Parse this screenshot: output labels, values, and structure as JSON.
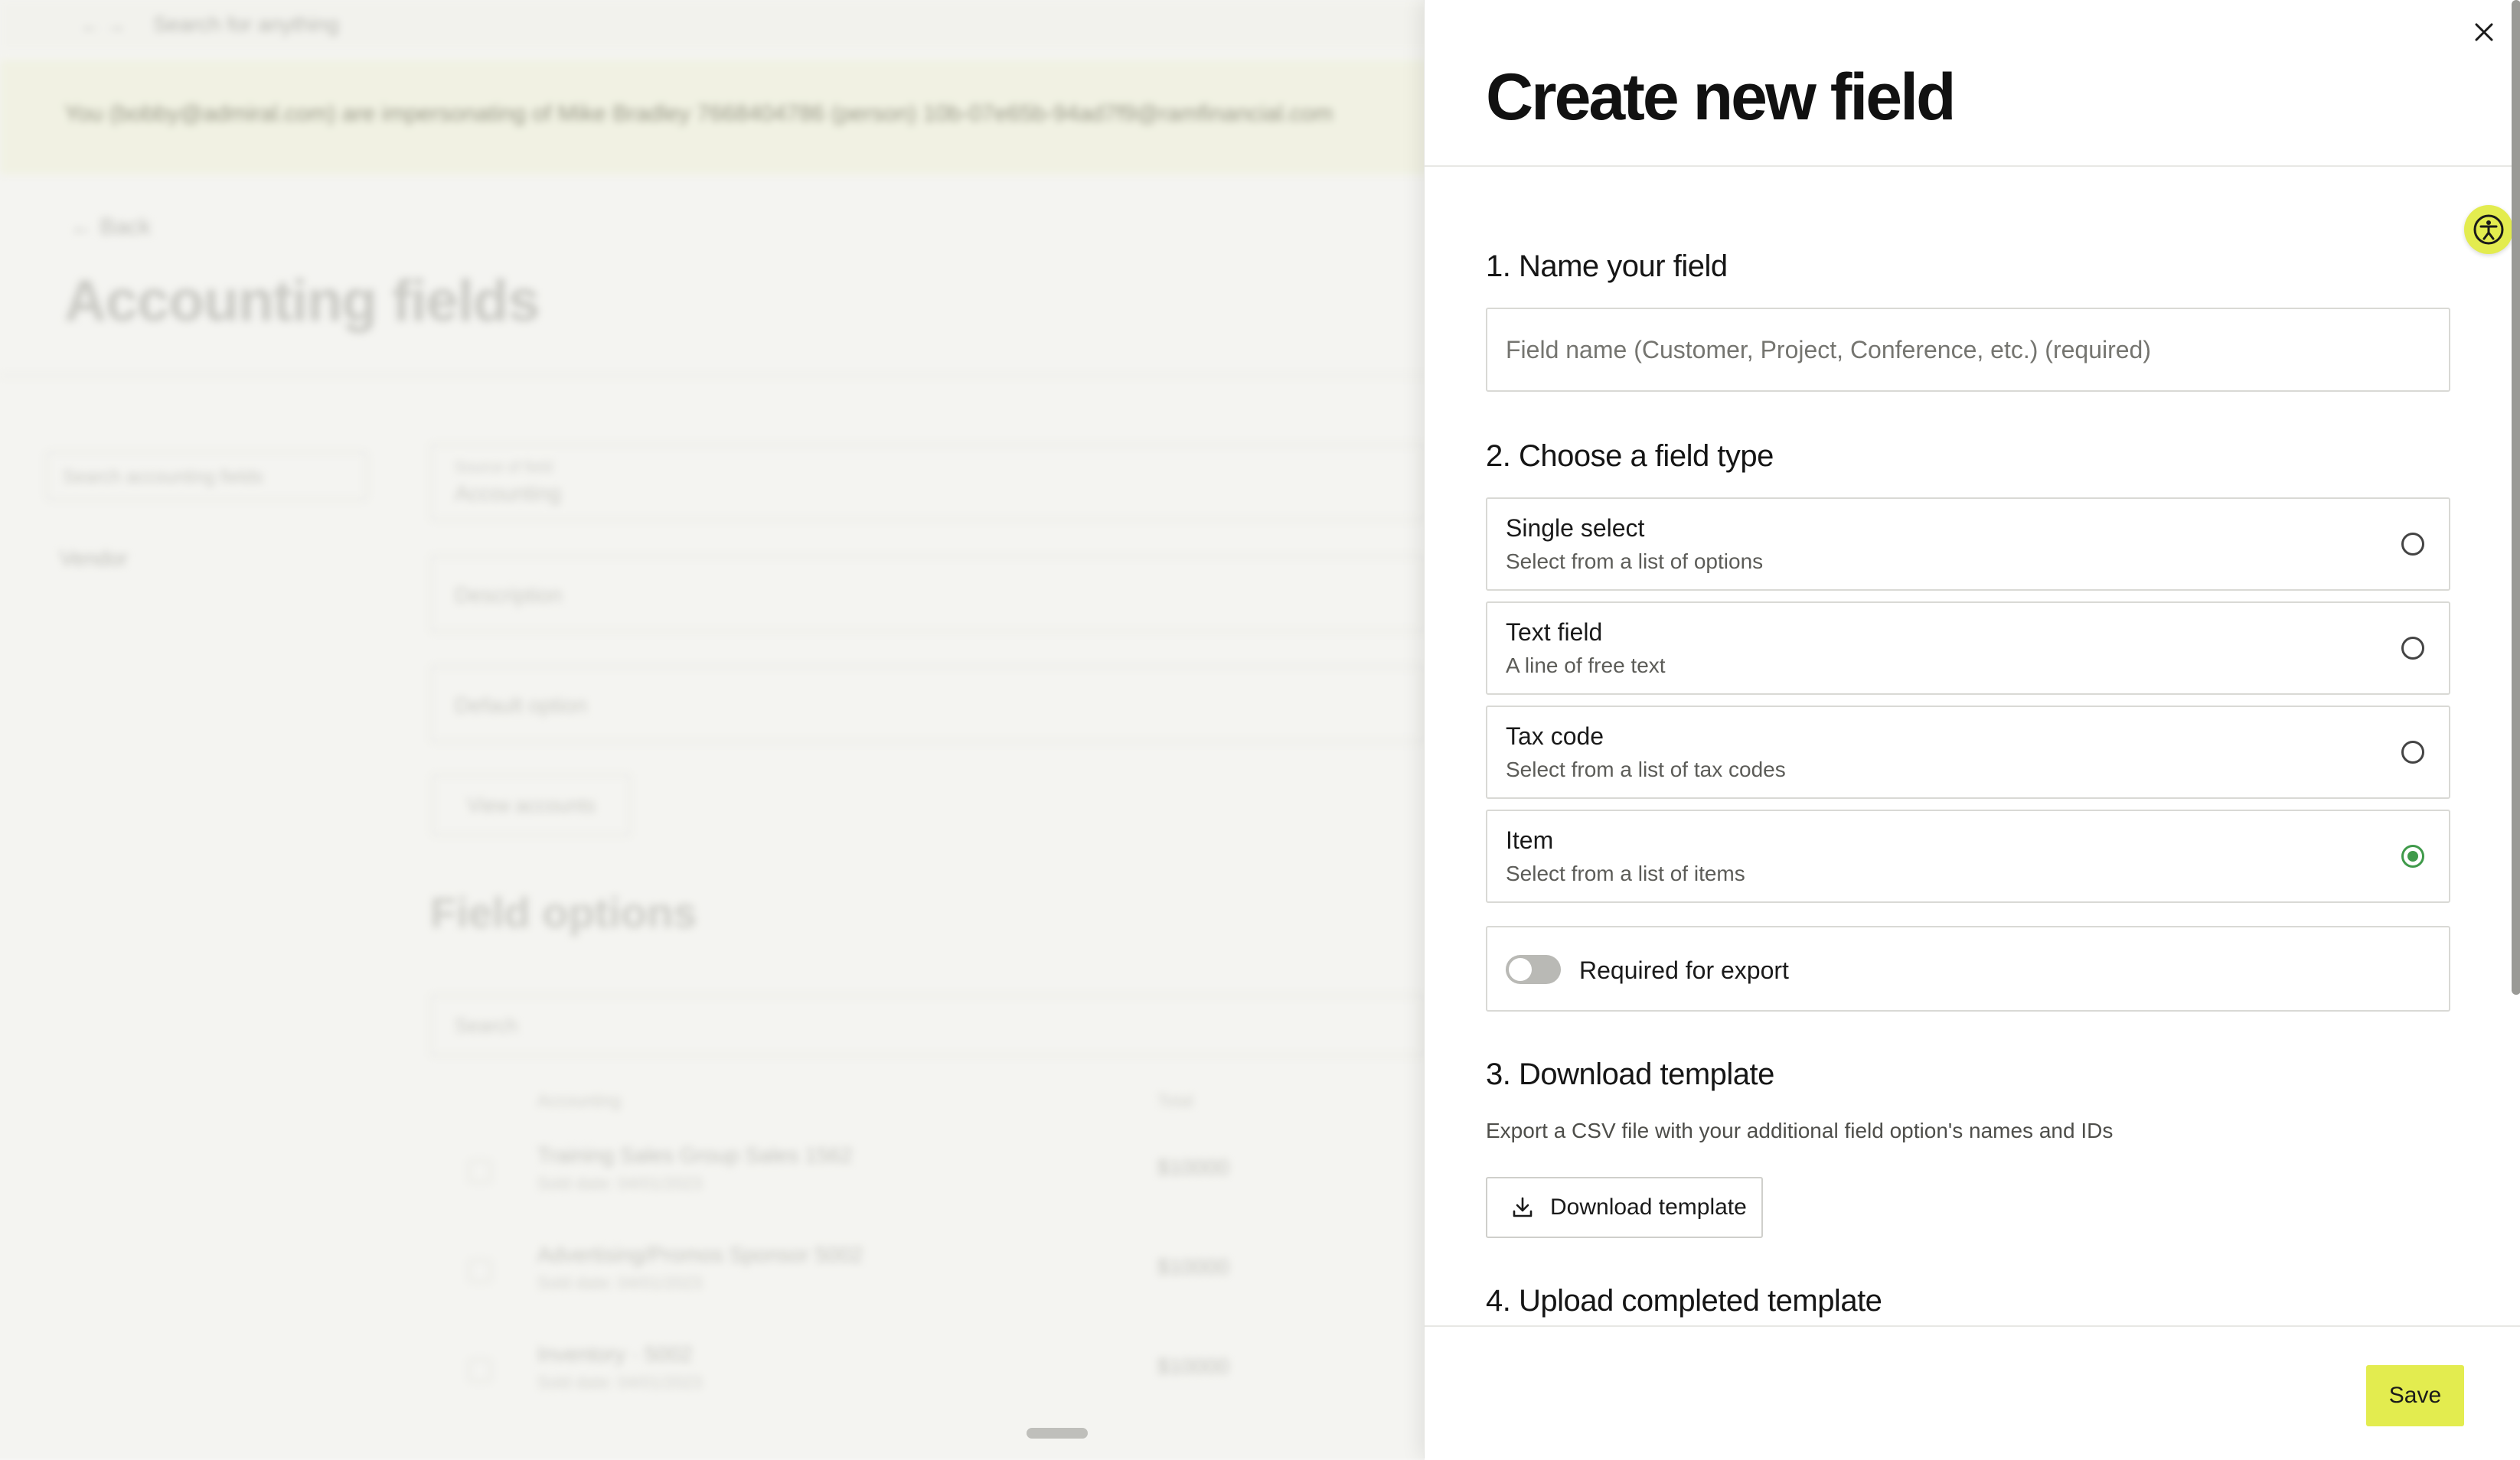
{
  "background": {
    "topbar": {
      "nav": "← →",
      "search_placeholder": "Search for anything"
    },
    "banner_text": "You (bobby@admiral.com) are impersonating of Mike Bradley 7668404786 (person) 10b-07e65b-94ad7f9@ramfinancial.com",
    "back_label": "← Back",
    "page_title": "Accounting fields",
    "sidebar": {
      "search_placeholder": "Search accounting fields",
      "item_label": "Vendor"
    },
    "fields": [
      {
        "label": "Source of field",
        "value": "Accounting"
      },
      {
        "label": "",
        "value": "Description"
      },
      {
        "label": "",
        "value": "Default option"
      }
    ],
    "view_button": "View accounts",
    "options_heading": "Field options",
    "table": {
      "search_placeholder": "Search",
      "headers": [
        "Accounting",
        "Total"
      ],
      "rows": [
        {
          "name": "Training Sales Group Sales 1562",
          "meta": "Sold date: 04/01/2023",
          "amount": "$10000"
        },
        {
          "name": "Advertising/Promos Sponsor 5002",
          "meta": "Sold date: 04/01/2023",
          "amount": "$10000"
        },
        {
          "name": "Inventory · 5002",
          "meta": "Sold date: 04/01/2023",
          "amount": "$10000"
        }
      ]
    }
  },
  "drawer": {
    "title": "Create new field",
    "close_icon": "close-icon",
    "accessibility_icon": "accessibility-icon",
    "section1": {
      "heading": "1. Name your field",
      "placeholder": "Field name (Customer, Project, Conference, etc.) (required)",
      "value": ""
    },
    "section2": {
      "heading": "2. Choose a field type",
      "options": [
        {
          "title": "Single select",
          "description": "Select from a list of options",
          "selected": false
        },
        {
          "title": "Text field",
          "description": "A line of free text",
          "selected": false
        },
        {
          "title": "Tax code",
          "description": "Select from a list of tax codes",
          "selected": false
        },
        {
          "title": "Item",
          "description": "Select from a list of items",
          "selected": true
        }
      ],
      "required_toggle": {
        "label": "Required for export",
        "on": false
      }
    },
    "section3": {
      "heading": "3. Download template",
      "description": "Export a CSV file with your additional field option's names and IDs",
      "button_label": "Download template",
      "button_icon": "download-icon"
    },
    "section4": {
      "heading": "4. Upload completed template"
    },
    "save_label": "Save"
  },
  "colors": {
    "accent": "#e3ec4f",
    "selected_radio": "#3f9a4a"
  }
}
